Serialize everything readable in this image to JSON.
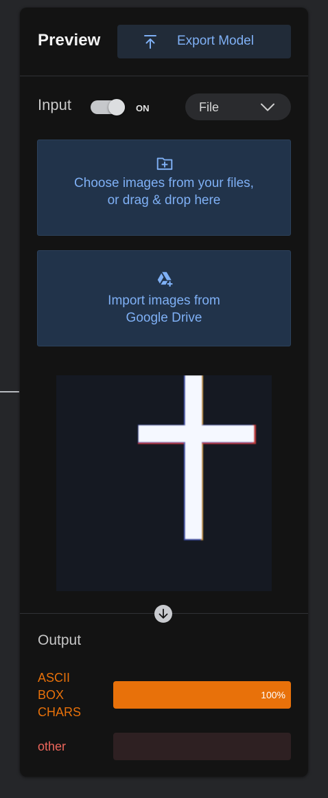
{
  "header": {
    "title": "Preview",
    "export_label": "Export Model"
  },
  "input": {
    "label": "Input",
    "toggle_state": "ON",
    "toggle_on": true,
    "source_value": "File"
  },
  "upload": {
    "files_line1": "Choose images from your files,",
    "files_line2": "or drag & drop here",
    "drive_line1": "Import images from",
    "drive_line2": "Google Drive"
  },
  "icons": {
    "export": "upload-arrow-icon",
    "dropdown": "chevron-down-icon",
    "files": "folder-plus-icon",
    "drive": "google-drive-add-icon",
    "scroll": "arrow-down-circle-icon"
  },
  "output": {
    "label": "Output",
    "classes": [
      {
        "name_lines": [
          "ASCII",
          "BOX",
          "CHARS"
        ],
        "confidence": 1.0,
        "percent_label": "100%",
        "color": "#e8710a",
        "track_color": "#3f2a12"
      },
      {
        "name_lines": [
          "other"
        ],
        "confidence": 0.0,
        "percent_label": "",
        "color": "#ee675c",
        "track_color": "#2e2022"
      }
    ]
  },
  "colors": {
    "accent_blue": "#7fb0f5",
    "panel_bg": "#131313",
    "page_bg": "#252629",
    "upload_bg": "#21334a"
  }
}
